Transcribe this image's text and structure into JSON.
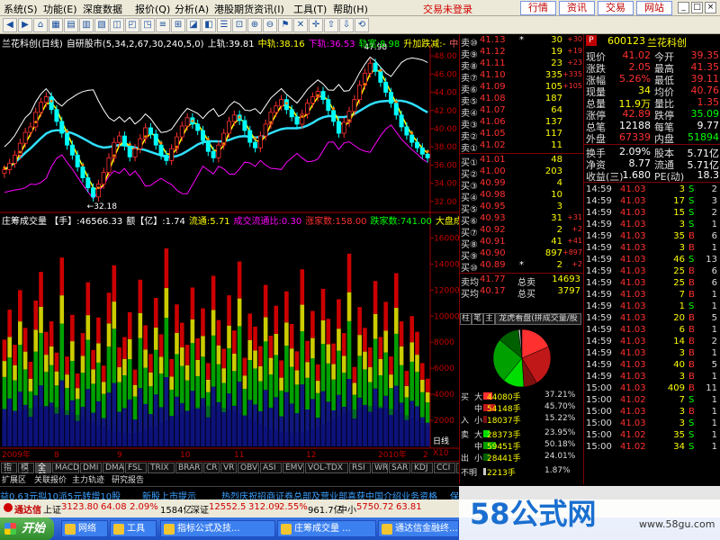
{
  "menu": {
    "items": [
      {
        "label": "系统(S)"
      },
      {
        "label": "功能(E)"
      },
      {
        "label": "深度数据"
      },
      {
        "label": "报价(Q)"
      },
      {
        "label": "分析(A)"
      },
      {
        "label": "港股期货"
      },
      {
        "label": "资讯(I)"
      },
      {
        "label": "工具(T)"
      },
      {
        "label": "帮助(H)"
      }
    ],
    "trade_status": "交易未登录",
    "quick_buttons": [
      "行情",
      "资讯",
      "交易",
      "网站"
    ]
  },
  "chart": {
    "title_segments": [
      {
        "text": "兰花科创(日线)",
        "color": "#ffffff"
      },
      {
        "text": "自研股市(5,34,2,67,30,240,5,0)",
        "color": "#ffffff"
      },
      {
        "text": "上轨:39.81",
        "color": "#ffffff"
      },
      {
        "text": "中轨:38.16",
        "color": "#ffff00"
      },
      {
        "text": "下轨:36.53",
        "color": "#ff00ff"
      },
      {
        "text": "轨宽:8.98",
        "color": "#00ff00"
      },
      {
        "text": "升加跌减:-",
        "color": "#ffff00"
      },
      {
        "text": "中期",
        "color": "#ff6060"
      }
    ],
    "price_axis": [
      "48.00",
      "46.00",
      "44.00",
      "42.00",
      "40.00",
      "38.00",
      "36.00",
      "34.00",
      "32.00"
    ],
    "high_label": "47.98",
    "low_label": "32.18",
    "volume_title": [
      {
        "text": "庄筹成交量 【手】:46566.33",
        "color": "#ffffff"
      },
      {
        "text": "额【亿】:1.74",
        "color": "#ffffff"
      },
      {
        "text": "流通:5.71",
        "color": "#ffff00"
      },
      {
        "text": "成交流通比:0.30",
        "color": "#ff00ff"
      },
      {
        "text": "涨家数:158.00",
        "color": "#ff3030"
      },
      {
        "text": "跌家数:741.00",
        "color": "#00ff00"
      },
      {
        "text": "大盘成",
        "color": "#ffff00"
      }
    ],
    "volume_axis": [
      "16000",
      "14000",
      "12000",
      "10000",
      "8000",
      "6000",
      "4000",
      "2000"
    ],
    "volume_unit": "X10",
    "period_label": "日线",
    "date_labels": [
      "2009年",
      "8",
      "9",
      "10",
      "11",
      "12",
      "2010年",
      "2"
    ]
  },
  "chart_data": {
    "type": "candlestick",
    "title": "兰花科创(日线)",
    "ylim": [
      31,
      49
    ],
    "volume_ylim": [
      0,
      17000
    ],
    "close": [
      35.5,
      36.2,
      37.1,
      38.4,
      39.6,
      40.2,
      41.8,
      42.9,
      43.5,
      42.1,
      40.8,
      39.5,
      38.2,
      37.1,
      35.8,
      34.6,
      33.5,
      32.5,
      33.9,
      35.2,
      36.8,
      38.5,
      39.2,
      38.1,
      36.9,
      37.8,
      38.9,
      40.1,
      39.4,
      38.2,
      37.1,
      36.5,
      37.8,
      39.1,
      40.3,
      41.2,
      40.5,
      39.8,
      38.7,
      37.5,
      36.8,
      38.2,
      39.5,
      40.8,
      41.5,
      40.9,
      39.8,
      38.5,
      37.9,
      39.2,
      40.5,
      41.8,
      42.5,
      43.2,
      42.1,
      41.3,
      40.5,
      41.6,
      42.8,
      43.5,
      44.1,
      43.2,
      42.0,
      40.8,
      39.5,
      40.7,
      41.9,
      43.2,
      44.8,
      46.1,
      47.2,
      46.3,
      45.1,
      44.0,
      42.8,
      41.5,
      40.2,
      39.3,
      38.5,
      37.9,
      37.2,
      36.8
    ],
    "volume": [
      8200,
      10500,
      7800,
      12000,
      9100,
      6500,
      11200,
      13400,
      8800,
      9600,
      7200,
      14500,
      6900,
      10100,
      5600,
      8700,
      12600,
      7400,
      9900,
      6200,
      11800,
      13900,
      7600,
      8400,
      10300,
      5900,
      12800,
      9300,
      7100,
      11400,
      8600,
      15200,
      6700,
      10900,
      9500,
      7800,
      12200,
      8300,
      10600,
      6400,
      13100,
      9700,
      7500,
      11600,
      8900,
      14200,
      6800,
      10200,
      9200,
      7700,
      12400,
      8500,
      10800,
      6600,
      11900,
      9400,
      7300,
      13600,
      8100,
      10400,
      6300,
      12100,
      9800,
      7900,
      11300,
      8700,
      14800,
      6100,
      10700,
      9100,
      7600,
      12700,
      8400,
      11100,
      6900,
      13300,
      9600,
      5800,
      10000,
      8800,
      6400,
      5200
    ]
  },
  "quote": {
    "sell": [
      {
        "label": "卖⑩",
        "price": "41.13",
        "vol": "30",
        "chg": "+30",
        "mark": "*"
      },
      {
        "label": "卖⑨",
        "price": "41.12",
        "vol": "19",
        "chg": "+19"
      },
      {
        "label": "卖⑧",
        "price": "41.11",
        "vol": "23",
        "chg": "+23"
      },
      {
        "label": "卖⑦",
        "price": "41.10",
        "vol": "335",
        "chg": "+335"
      },
      {
        "label": "卖⑥",
        "price": "41.09",
        "vol": "105",
        "chg": "+105"
      },
      {
        "label": "卖⑤",
        "price": "41.08",
        "vol": "187",
        "chg": ""
      },
      {
        "label": "卖④",
        "price": "41.07",
        "vol": "64",
        "chg": ""
      },
      {
        "label": "卖③",
        "price": "41.06",
        "vol": "137",
        "chg": ""
      },
      {
        "label": "卖②",
        "price": "41.05",
        "vol": "117",
        "chg": ""
      },
      {
        "label": "卖①",
        "price": "41.02",
        "vol": "11",
        "chg": ""
      }
    ],
    "buy": [
      {
        "label": "买①",
        "price": "41.01",
        "vol": "48",
        "chg": ""
      },
      {
        "label": "买②",
        "price": "41.00",
        "vol": "203",
        "chg": ""
      },
      {
        "label": "买③",
        "price": "40.99",
        "vol": "4",
        "chg": ""
      },
      {
        "label": "买④",
        "price": "40.98",
        "vol": "10",
        "chg": ""
      },
      {
        "label": "买⑤",
        "price": "40.95",
        "vol": "3",
        "chg": ""
      },
      {
        "label": "买⑥",
        "price": "40.93",
        "vol": "31",
        "chg": "+31"
      },
      {
        "label": "买⑦",
        "price": "40.92",
        "vol": "2",
        "chg": "+2"
      },
      {
        "label": "买⑧",
        "price": "40.91",
        "vol": "41",
        "chg": "+41"
      },
      {
        "label": "买⑨",
        "price": "40.90",
        "vol": "897",
        "chg": "+897"
      },
      {
        "label": "买⑩",
        "price": "40.89",
        "vol": "2",
        "chg": "+2",
        "mark": "*"
      }
    ],
    "avg": [
      {
        "label": "卖均",
        "price": "41.77",
        "label2": "总卖",
        "vol": "14693"
      },
      {
        "label": "买均",
        "price": "40.17",
        "label2": "总买",
        "vol": "3797"
      }
    ],
    "tabs": [
      "柱",
      "笔",
      "主",
      "龙虎看盘(拼成交量/股"
    ],
    "flow_rows": [
      {
        "side": "买",
        "size": "大",
        "vol": "44080手",
        "pct": "37.21%",
        "color": "#ff3030",
        "frac": 0.37
      },
      {
        "side": "",
        "size": "中",
        "vol": "54148手",
        "pct": "45.70%",
        "color": "#c01818",
        "frac": 0.46
      },
      {
        "side": "入",
        "size": "小",
        "vol": "18037手",
        "pct": "15.22%",
        "color": "#801010",
        "frac": 0.15
      },
      {
        "side": "卖",
        "size": "大",
        "vol": "28373手",
        "pct": "23.95%",
        "color": "#00dd00",
        "frac": 0.24
      },
      {
        "side": "",
        "size": "中",
        "vol": "59451手",
        "pct": "50.18%",
        "color": "#00a000",
        "frac": 0.5
      },
      {
        "side": "出",
        "size": "小",
        "vol": "28441手",
        "pct": "24.01%",
        "color": "#006000",
        "frac": 0.24
      },
      {
        "side": "不明",
        "size": "",
        "vol": "2213手",
        "pct": "1.87%",
        "color": "#cccccc",
        "frac": 0.02
      }
    ]
  },
  "info": {
    "code_marker": "P",
    "code": "600123",
    "name": "兰花科创",
    "rows": [
      {
        "l1": "现价",
        "v1": "41.02",
        "c1": "#ff3030",
        "l2": "今开",
        "v2": "39.35",
        "c2": "#ff3030"
      },
      {
        "l1": "涨跌",
        "v1": "2.05",
        "c1": "#ff3030",
        "l2": "最高",
        "v2": "41.35",
        "c2": "#ff3030"
      },
      {
        "l1": "涨幅",
        "v1": "5.26%",
        "c1": "#ff3030",
        "l2": "最低",
        "v2": "39.11",
        "c2": "#ff3030"
      },
      {
        "l1": "现量",
        "v1": "34",
        "c1": "#ffff00",
        "l2": "均价",
        "v2": "40.76",
        "c2": "#ff3030"
      },
      {
        "l1": "总量",
        "v1": "11.9万",
        "c1": "#ffff00",
        "l2": "量比",
        "v2": "1.35",
        "c2": "#ff3030"
      },
      {
        "l1": "涨停",
        "v1": "42.89",
        "c1": "#ff3030",
        "l2": "跌停",
        "v2": "35.09",
        "c2": "#00ff00"
      },
      {
        "l1": "总笔",
        "v1": "12188",
        "c1": "#ffffff",
        "l2": "每笔",
        "v2": "9.77",
        "c2": "#ffffff"
      },
      {
        "l1": "外盘",
        "v1": "67339",
        "c1": "#ff3030",
        "l2": "内盘",
        "v2": "51894",
        "c2": "#00ff00"
      },
      {
        "l1": "换手",
        "v1": "2.09%",
        "c1": "#ffffff",
        "l2": "股本",
        "v2": "5.71亿",
        "c2": "#ffffff"
      },
      {
        "l1": "净资",
        "v1": "8.77",
        "c1": "#ffffff",
        "l2": "流通",
        "v2": "5.71亿",
        "c2": "#ffffff"
      },
      {
        "l1": "收益(三)",
        "v1": "1.680",
        "c1": "#ffffff",
        "l2": "PE(动)",
        "v2": "18.3",
        "c2": "#ffffff"
      }
    ],
    "ticks": [
      {
        "time": "14:59",
        "price": "41.03",
        "vol": "3",
        "dir": "S",
        "n": "2"
      },
      {
        "time": "14:59",
        "price": "41.03",
        "vol": "17",
        "dir": "S",
        "n": "3"
      },
      {
        "time": "14:59",
        "price": "41.03",
        "vol": "15",
        "dir": "S",
        "n": "2"
      },
      {
        "time": "14:59",
        "price": "41.03",
        "vol": "3",
        "dir": "S",
        "n": "1"
      },
      {
        "time": "14:59",
        "price": "41.03",
        "vol": "35",
        "dir": "B",
        "n": "6"
      },
      {
        "time": "14:59",
        "price": "41.03",
        "vol": "3",
        "dir": "B",
        "n": "1"
      },
      {
        "time": "14:59",
        "price": "41.03",
        "vol": "46",
        "dir": "S",
        "n": "13"
      },
      {
        "time": "14:59",
        "price": "41.03",
        "vol": "25",
        "dir": "B",
        "n": "6"
      },
      {
        "time": "14:59",
        "price": "41.03",
        "vol": "25",
        "dir": "B",
        "n": "6"
      },
      {
        "time": "14:59",
        "price": "41.03",
        "vol": "7",
        "dir": "B",
        "n": "1"
      },
      {
        "time": "14:59",
        "price": "41.03",
        "vol": "1",
        "dir": "S",
        "n": "1"
      },
      {
        "time": "14:59",
        "price": "41.03",
        "vol": "20",
        "dir": "B",
        "n": "5"
      },
      {
        "time": "14:59",
        "price": "41.03",
        "vol": "6",
        "dir": "B",
        "n": "1"
      },
      {
        "time": "14:59",
        "price": "41.03",
        "vol": "14",
        "dir": "B",
        "n": "2"
      },
      {
        "time": "14:59",
        "price": "41.03",
        "vol": "3",
        "dir": "B",
        "n": "1"
      },
      {
        "time": "14:59",
        "price": "41.03",
        "vol": "40",
        "dir": "B",
        "n": "5"
      },
      {
        "time": "14:59",
        "price": "41.03",
        "vol": "3",
        "dir": "B",
        "n": "1"
      },
      {
        "time": "15:00",
        "price": "41.03",
        "vol": "409",
        "dir": "B",
        "n": "11"
      },
      {
        "time": "15:00",
        "price": "41.02",
        "vol": "7",
        "dir": "S",
        "n": "1"
      },
      {
        "time": "15:00",
        "price": "41.03",
        "vol": "3",
        "dir": "B",
        "n": "1"
      },
      {
        "time": "15:00",
        "price": "41.03",
        "vol": "3",
        "dir": "S",
        "n": "1"
      },
      {
        "time": "15:00",
        "price": "41.02",
        "vol": "35",
        "dir": "S",
        "n": "1"
      },
      {
        "time": "15:00",
        "price": "41.02",
        "vol": "34",
        "dir": "S",
        "n": "1"
      }
    ]
  },
  "bottom_tabs": [
    "指标",
    "模板",
    "全部",
    "MACD",
    "DMI",
    "DMA",
    "FSL",
    "TRIX",
    "BRAR",
    "CR",
    "VR",
    "OBV",
    "ASI",
    "EMV",
    "VOL-TDX",
    "RSI",
    "WR",
    "SAR",
    "KDJ",
    "CCI",
    "ROC",
    "MTM",
    "BOLL"
  ],
  "sub_tabs": [
    "扩展区",
    "关联报价",
    "主力轨迹",
    "研究报告"
  ],
  "ticker": {
    "items": [
      "益0.63元拟10派5元转增10股",
      "新股上市提示",
      "热烈庆祝招商证券总部及营业部喜获中国介绍业务资格",
      "保"
    ]
  },
  "index_bar": {
    "brand": "通达信",
    "sh_label": "上证",
    "sh_val": "3123.80",
    "sh_chg": "64.08",
    "sh_pct": "2.09%",
    "sh_amt": "1584亿",
    "sz_label": "深证",
    "sz_val": "12552.5",
    "sz_chg": "312.09",
    "sz_pct": "2.55%",
    "sz_amt": "961.7亿",
    "zx_label": "中小",
    "zx_val": "5750.72",
    "zx_chg": "63.81"
  },
  "taskbar": {
    "start_label": "开始",
    "items": [
      "网络",
      "工具",
      "指标公式及技...",
      "庄筹成交量 ...",
      "通达信金融终..."
    ]
  },
  "watermark": {
    "big": "58公式网",
    "small": "www.58gu.com"
  }
}
